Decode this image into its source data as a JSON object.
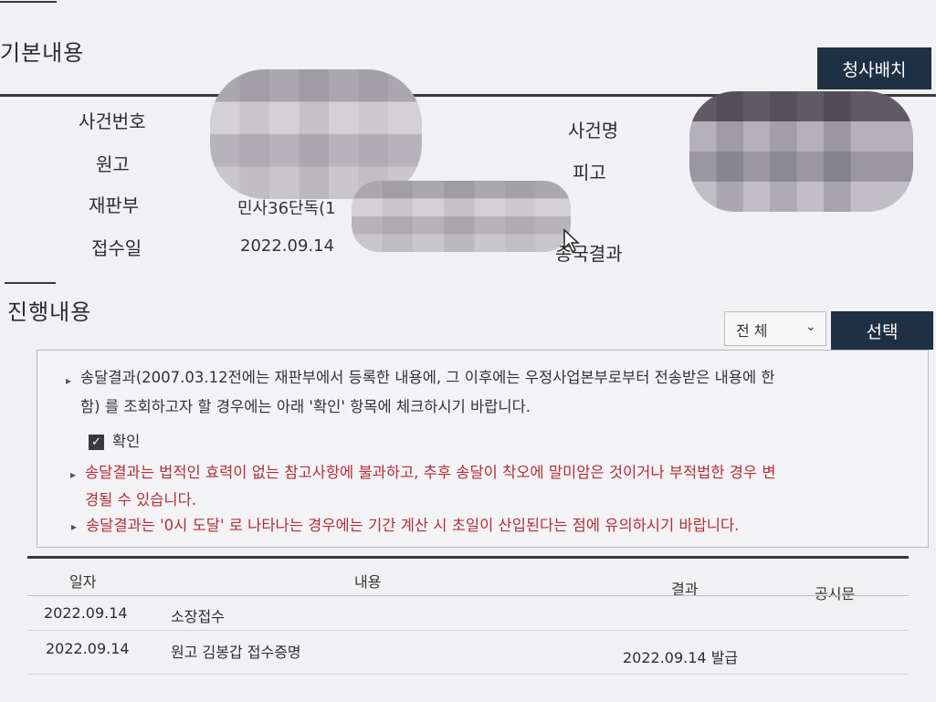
{
  "basic": {
    "title": "기본내용",
    "dispatch_button": "청사배치",
    "labels": {
      "case_number": "사건번호",
      "case_name": "사건명",
      "plaintiff": "원고",
      "defendant": "피고",
      "court_division": "재판부",
      "received_date": "접수일",
      "final_result": "종국결과"
    },
    "values": {
      "court_division": "민사36단독(1",
      "received_date": "2022.09.14"
    }
  },
  "progress": {
    "title": "진행내용",
    "filter_selected": "전 체",
    "select_button": "선택",
    "notices": {
      "line1a": "송달결과(2007.03.12전에는 재판부에서 등록한 내용에, 그 이후에는 우정사업본부로부터 전송받은 내용에 한",
      "line1b": "함) 를 조회하고자 할 경우에는 아래 '확인' 항목에 체크하시기 바랍니다.",
      "confirm_label": "확인",
      "line2a": "송달결과는 법적인 효력이 없는 참고사항에 불과하고, 추후 송달이 착오에 말미암은 것이거나 부적법한 경우 변",
      "line2b": "경될 수 있습니다.",
      "line3": "송달결과는 '0시 도달' 로 나타나는 경우에는 기간 계산 시 초일이 산입된다는 점에 유의하시기 바랍니다."
    },
    "table": {
      "headers": {
        "date": "일자",
        "content": "내용",
        "result": "결과",
        "notice": "공시문"
      },
      "rows": [
        {
          "date": "2022.09.14",
          "content": "소장접수",
          "result": ""
        },
        {
          "date": "2022.09.14",
          "content": "원고 김봉갑 접수증명",
          "result": "2022.09.14 발급"
        }
      ]
    }
  },
  "colors": {
    "dark_button": "#1f2f44",
    "warning_text": "#b0303a"
  }
}
